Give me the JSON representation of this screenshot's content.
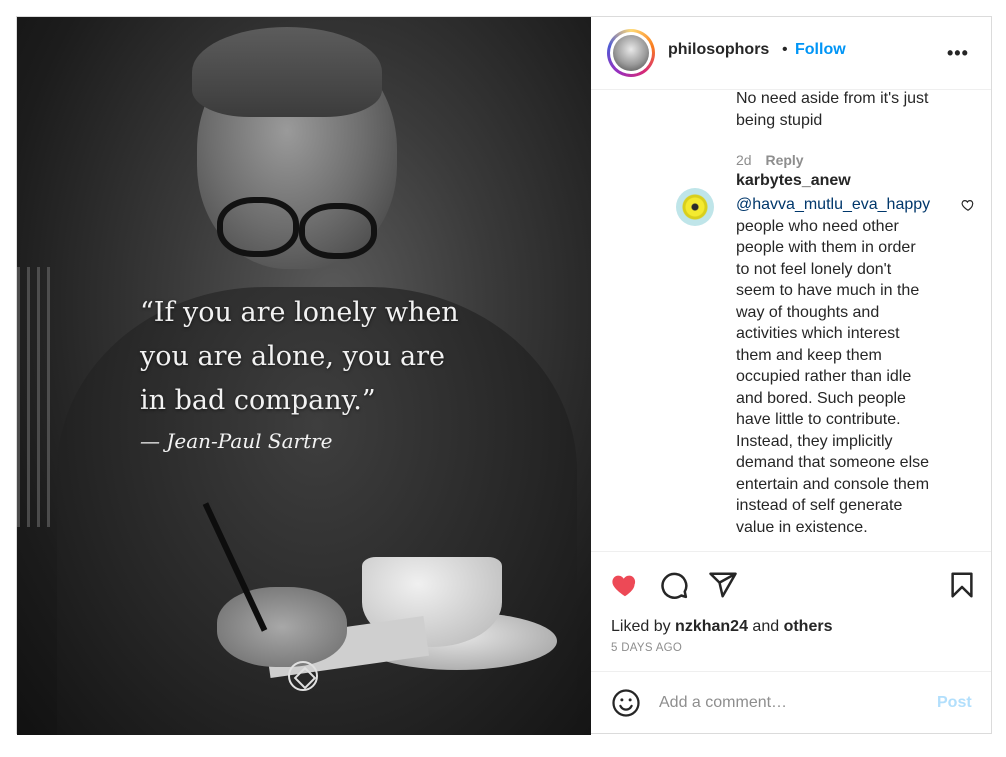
{
  "post": {
    "image": {
      "quote_lines": [
        "“If you are lonely when",
        "you are alone, you are",
        "in bad company.”"
      ],
      "author": "— Jean-Paul Sartre"
    },
    "header": {
      "username": "philosophors",
      "separator": "•",
      "follow_label": "Follow",
      "more_label": "•••"
    },
    "comments": {
      "partial_reply": {
        "lines": [
          "No need aside from it's just",
          "being stupid"
        ],
        "time": "2d",
        "reply_label": "Reply"
      },
      "comment": {
        "username": "karbytes_anew",
        "mention": "@havva_mutlu_eva_happy",
        "lines": [
          "people who need other",
          "people with them in order",
          "to not feel lonely don't",
          "seem to have much in the",
          "way of thoughts and",
          "activities which interest",
          "them and keep them",
          "occupied rather than idle",
          "and bored. Such people",
          "have little to contribute.",
          "Instead, they implicitly",
          "demand that someone else",
          "entertain and console them",
          "instead of self generate",
          "value in existence."
        ]
      }
    },
    "likes": {
      "prefix": "Liked by",
      "user": "nzkhan24",
      "and": "and",
      "others": "others"
    },
    "date": "5 DAYS AGO",
    "add_comment": {
      "placeholder": "Add a comment…",
      "post_label": "Post"
    },
    "colors": {
      "like_red": "#ed4956",
      "link_blue": "#0095f6",
      "mention_blue": "#00376b",
      "post_disabled": "#b2dffc"
    },
    "icons": [
      "heart-filled-icon",
      "comment-icon",
      "share-icon",
      "bookmark-icon",
      "emoji-icon",
      "heart-outline-icon",
      "watermark-logo-icon"
    ]
  }
}
